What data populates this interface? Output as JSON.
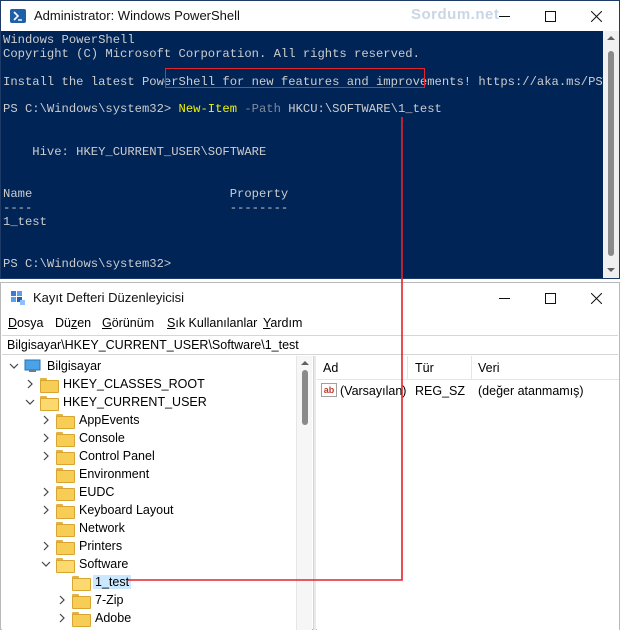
{
  "powershell": {
    "title": "Administrator: Windows PowerShell",
    "watermark": "Sordum.net",
    "lines": {
      "l1": "Windows PowerShell",
      "l2": "Copyright (C) Microsoft Corporation. All rights reserved.",
      "l3": "Install the latest PowerShell for new features and improvements! https://aka.ms/PSWindows",
      "prompt1": "PS C:\\Windows\\system32> ",
      "cmd_name": "New-Item",
      "cmd_param": " -Path",
      "cmd_value": " HKCU:\\SOFTWARE\\1_test",
      "hive": "    Hive: HKEY_CURRENT_USER\\SOFTWARE",
      "col_headers": "Name                           Property",
      "col_dashes": "----                           --------",
      "result": "1_test",
      "prompt2": "PS C:\\Windows\\system32>"
    }
  },
  "regedit": {
    "title": "Kayıt Defteri Düzenleyicisi",
    "menu": {
      "file": {
        "u": "D",
        "rest": "osya"
      },
      "edit": {
        "pre": "Dü",
        "u": "z",
        "rest": "en"
      },
      "view": {
        "u": "G",
        "rest": "örünüm"
      },
      "favorites": {
        "pre": "",
        "u": "S",
        "rest": "ık Kullanılanlar"
      },
      "help": {
        "u": "Y",
        "rest": "ardım"
      }
    },
    "address": "Bilgisayar\\HKEY_CURRENT_USER\\Software\\1_test",
    "tree": {
      "computer": "Bilgisayar",
      "hkcr": "HKEY_CLASSES_ROOT",
      "hkcu": "HKEY_CURRENT_USER",
      "appevents": "AppEvents",
      "console": "Console",
      "controlpanel": "Control Panel",
      "environment": "Environment",
      "eudc": "EUDC",
      "keyboardlayout": "Keyboard Layout",
      "network": "Network",
      "printers": "Printers",
      "software": "Software",
      "test": "1_test",
      "zip": "7-Zip",
      "adobe": "Adobe"
    },
    "values_header": {
      "name": "Ad",
      "type": "Tür",
      "data": "Veri"
    },
    "values": [
      {
        "name": "(Varsayılan)",
        "type": "REG_SZ",
        "data": "(değer atanmamış)",
        "icon": "ab"
      }
    ]
  },
  "colors": {
    "ps_background": "#012456",
    "highlight_border": "#e3242b",
    "selection": "#cce8ff"
  }
}
